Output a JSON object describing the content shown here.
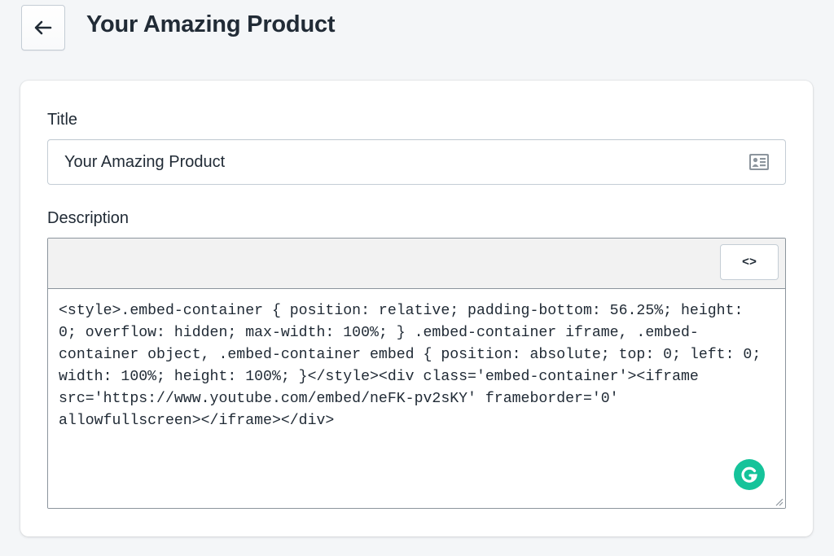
{
  "header": {
    "back_icon": "arrow-left-icon",
    "title": "Your Amazing Product"
  },
  "form": {
    "title_label": "Title",
    "title_value": "Your Amazing Product",
    "title_icon": "contact-card-icon",
    "description_label": "Description",
    "code_toggle_label": "<>",
    "description_html": "<style>.embed-container { position: relative; padding-bottom: 56.25%; height: 0; overflow: hidden; max-width: 100%; } .embed-container iframe, .embed-container object, .embed-container embed { position: absolute; top: 0; left: 0; width: 100%; height: 100%; }</style><div class='embed-container'><iframe src='https://www.youtube.com/embed/neFK-pv2sKY' frameborder='0' allowfullscreen></iframe></div>",
    "grammarly_icon": "grammarly-icon"
  },
  "colors": {
    "background": "#f4f6f8",
    "card": "#ffffff",
    "toolbar": "#f2f2f2",
    "grammarly_green": "#15c39a",
    "text": "#212b36"
  }
}
